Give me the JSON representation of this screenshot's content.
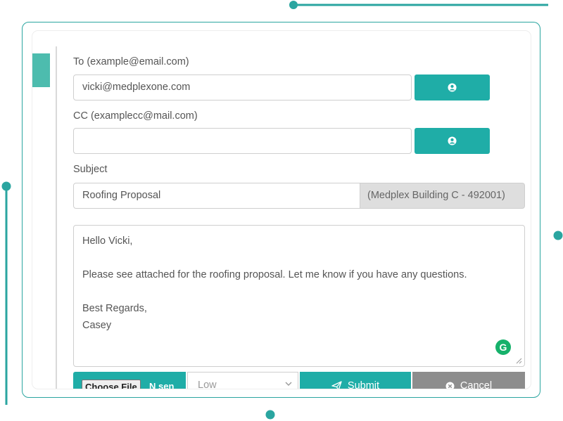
{
  "form": {
    "to_label": "To (example@email.com)",
    "to_value": "vicki@medplexone.com",
    "cc_label": "CC (examplecc@mail.com)",
    "cc_value": "",
    "subject_label": "Subject",
    "subject_value": "Roofing Proposal",
    "subject_suffix": "(Medplex Building C - 492001)",
    "body_lines": [
      "Hello Vicki,",
      "",
      "Please see attached for the roofing proposal. Let me know if you have any questions.",
      "",
      "Best Regards,",
      "Casey"
    ],
    "grammarly_letter": "G",
    "choose_file_label": "Choose File",
    "no_file_text": "N sen",
    "priority_value": "Low",
    "submit_label": "Submit",
    "cancel_label": "Cancel"
  },
  "colors": {
    "accent": "#1fada7",
    "frame": "#2aa5a0",
    "cancel": "#8d8d8d",
    "grammarly": "#16b16b"
  },
  "icons": {
    "contact": "user-circle-icon",
    "submit": "paper-plane-icon",
    "cancel": "circle-x-icon",
    "select": "chevron-down-icon",
    "grammarly": "grammarly-icon"
  }
}
